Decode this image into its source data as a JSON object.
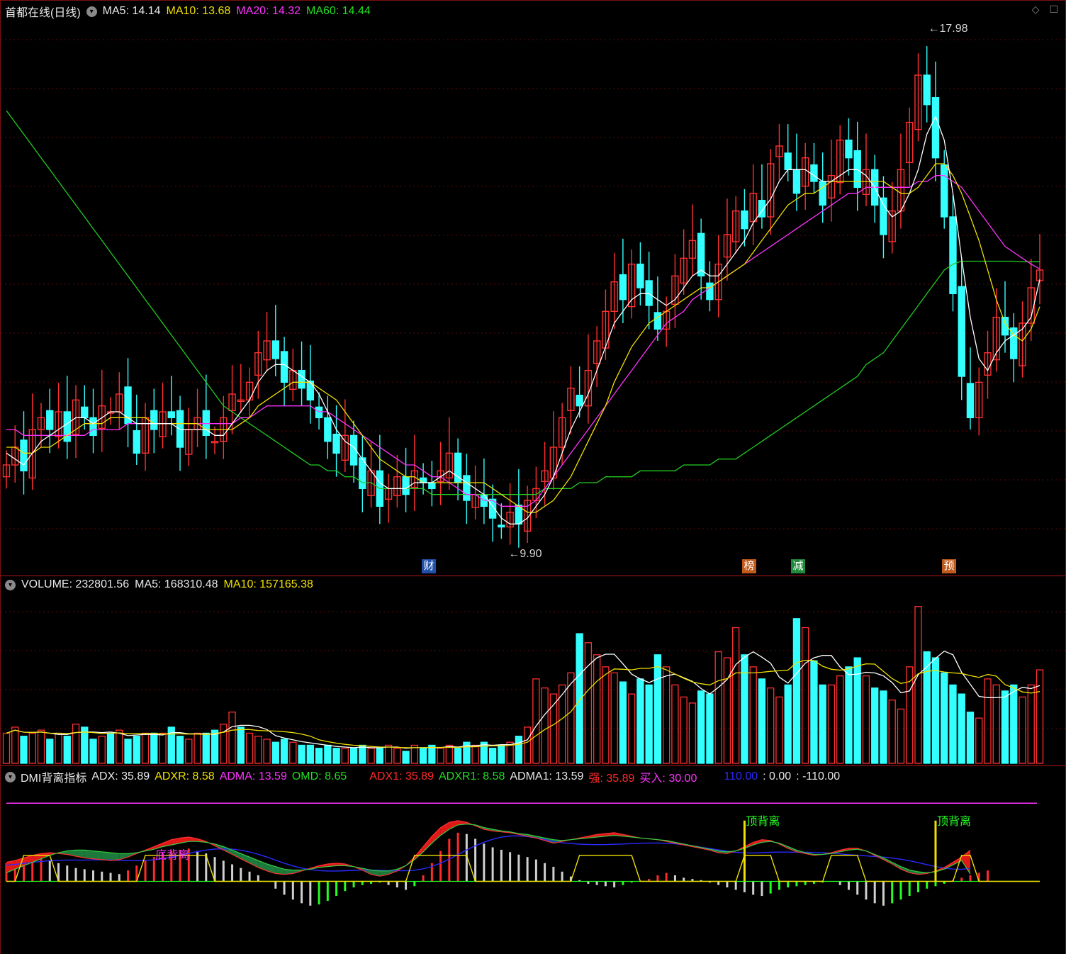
{
  "price": {
    "title": "首都在线(日线)",
    "ma5_label": "MA5:",
    "ma5": "14.14",
    "ma10_label": "MA10:",
    "ma10": "13.68",
    "ma20_label": "MA20:",
    "ma20": "14.32",
    "ma60_label": "MA60:",
    "ma60": "14.44",
    "high_label": "17.98",
    "low_label": "9.90",
    "signals": [
      {
        "text": "财",
        "color": "#1f4fa8"
      },
      {
        "text": "榜",
        "color": "#c05a1a"
      },
      {
        "text": "减",
        "color": "#1f8a3a"
      },
      {
        "text": "预",
        "color": "#c05a1a"
      }
    ],
    "icons": [
      "diamond-icon",
      "maximize-icon"
    ]
  },
  "volume": {
    "label": "VOLUME:",
    "value": "232801.56",
    "ma5_label": "MA5:",
    "ma5": "168310.48",
    "ma10_label": "MA10:",
    "ma10": "157165.38"
  },
  "dmi": {
    "title": "DMI背离指标",
    "adx_label": "ADX:",
    "adx": "35.89",
    "adxr_label": "ADXR:",
    "adxr": "8.58",
    "adma_label": "ADMA:",
    "adma": "13.59",
    "omd_label": "OMD:",
    "omd": "8.65",
    "adx1_label": "ADX1:",
    "adx1": "35.89",
    "adxr1_label": "ADXR1:",
    "adxr1": "8.58",
    "adma1_label": "ADMA1:",
    "adma1": "13.59",
    "strong_label": "强:",
    "strong": "35.89",
    "buy_label": "买入:",
    "buy": "30.00",
    "v1": "110.00",
    "v2_label": ":",
    "v2": "0.00",
    "v3_label": ":",
    "v3": "-110.00",
    "annotations": [
      "底背离",
      "顶背离",
      "顶背离"
    ]
  },
  "colors": {
    "up": "#ff3030",
    "down": "#33ffff",
    "ma5": "#ffffff",
    "ma10": "#f0e000",
    "ma20": "#ff33ff",
    "ma60": "#22cc22"
  },
  "chart_data": {
    "type": "candlestick",
    "n": 120,
    "price_range": [
      9.5,
      18.5
    ],
    "close": [
      11.0,
      11.3,
      10.9,
      11.6,
      11.8,
      11.6,
      11.9,
      11.4,
      12.1,
      11.8,
      11.5,
      12.0,
      11.9,
      12.2,
      11.7,
      11.2,
      11.8,
      11.6,
      11.9,
      11.8,
      11.3,
      11.6,
      11.8,
      11.5,
      11.4,
      11.8,
      12.2,
      12.1,
      12.4,
      12.9,
      13.1,
      12.8,
      12.4,
      12.6,
      12.3,
      12.1,
      11.8,
      11.4,
      11.2,
      11.5,
      11.0,
      10.6,
      10.9,
      10.3,
      10.6,
      10.8,
      10.5,
      10.9,
      10.7,
      10.6,
      10.9,
      11.2,
      10.7,
      10.4,
      10.5,
      10.3,
      10.1,
      9.95,
      10.2,
      10.0,
      10.4,
      10.6,
      10.9,
      11.3,
      11.8,
      12.3,
      12.0,
      12.6,
      13.1,
      13.6,
      14.1,
      13.8,
      14.4,
      14.0,
      13.7,
      13.3,
      13.6,
      14.2,
      14.5,
      14.8,
      14.2,
      13.8,
      14.4,
      14.9,
      15.3,
      15.0,
      15.6,
      15.2,
      16.1,
      16.4,
      16.0,
      15.6,
      16.2,
      15.8,
      15.4,
      15.9,
      16.5,
      16.2,
      15.7,
      16.0,
      15.4,
      14.9,
      15.3,
      16.0,
      16.8,
      17.6,
      17.1,
      16.2,
      15.2,
      13.9,
      12.5,
      11.8,
      12.4,
      12.9,
      13.5,
      13.2,
      12.8,
      13.4,
      14.0,
      14.3
    ],
    "ma5": [
      11.2,
      11.1,
      11.0,
      11.2,
      11.4,
      11.5,
      11.6,
      11.7,
      11.8,
      11.8,
      11.7,
      11.8,
      11.9,
      11.9,
      11.8,
      11.7,
      11.7,
      11.7,
      11.7,
      11.7,
      11.6,
      11.6,
      11.6,
      11.6,
      11.5,
      11.5,
      11.7,
      11.9,
      12.1,
      12.4,
      12.6,
      12.7,
      12.7,
      12.6,
      12.5,
      12.4,
      12.2,
      11.9,
      11.6,
      11.4,
      11.3,
      11.1,
      10.9,
      10.7,
      10.6,
      10.6,
      10.6,
      10.7,
      10.7,
      10.7,
      10.8,
      10.9,
      10.8,
      10.7,
      10.6,
      10.5,
      10.3,
      10.1,
      10.0,
      10.0,
      10.1,
      10.3,
      10.5,
      10.8,
      11.2,
      11.6,
      11.9,
      12.2,
      12.6,
      13.0,
      13.4,
      13.6,
      13.8,
      13.9,
      13.9,
      13.8,
      13.7,
      13.8,
      14.0,
      14.2,
      14.3,
      14.2,
      14.2,
      14.4,
      14.6,
      14.8,
      15.1,
      15.3,
      15.5,
      15.8,
      16.0,
      16.0,
      16.0,
      15.9,
      15.8,
      15.8,
      15.9,
      16.0,
      16.0,
      15.9,
      15.7,
      15.4,
      15.2,
      15.3,
      15.6,
      16.0,
      16.6,
      16.9,
      16.5,
      15.6,
      14.5,
      13.5,
      12.8,
      12.6,
      12.9,
      13.1,
      13.2,
      13.3,
      13.5,
      14.14
    ],
    "ma10": [
      11.3,
      11.3,
      11.2,
      11.2,
      11.3,
      11.3,
      11.4,
      11.5,
      11.6,
      11.7,
      11.7,
      11.7,
      11.8,
      11.8,
      11.8,
      11.8,
      11.8,
      11.7,
      11.7,
      11.7,
      11.7,
      11.7,
      11.7,
      11.6,
      11.6,
      11.6,
      11.6,
      11.7,
      11.8,
      12.0,
      12.1,
      12.2,
      12.3,
      12.4,
      12.4,
      12.4,
      12.3,
      12.2,
      12.1,
      11.9,
      11.7,
      11.5,
      11.3,
      11.1,
      11.0,
      10.9,
      10.8,
      10.8,
      10.7,
      10.7,
      10.7,
      10.7,
      10.7,
      10.7,
      10.7,
      10.7,
      10.6,
      10.5,
      10.4,
      10.3,
      10.2,
      10.2,
      10.3,
      10.4,
      10.6,
      10.8,
      11.1,
      11.4,
      11.7,
      12.0,
      12.4,
      12.7,
      13.0,
      13.2,
      13.4,
      13.5,
      13.6,
      13.7,
      13.8,
      13.9,
      14.0,
      14.0,
      14.1,
      14.2,
      14.3,
      14.4,
      14.6,
      14.8,
      15.0,
      15.2,
      15.4,
      15.5,
      15.6,
      15.6,
      15.7,
      15.8,
      15.8,
      15.8,
      15.8,
      15.8,
      15.8,
      15.8,
      15.7,
      15.6,
      15.6,
      15.7,
      15.9,
      16.1,
      16.1,
      15.9,
      15.6,
      15.2,
      14.8,
      14.3,
      13.8,
      13.4,
      13.2,
      13.1,
      13.3,
      13.68
    ],
    "ma20": [
      11.6,
      11.6,
      11.5,
      11.5,
      11.5,
      11.5,
      11.5,
      11.5,
      11.5,
      11.5,
      11.6,
      11.6,
      11.6,
      11.6,
      11.7,
      11.7,
      11.7,
      11.7,
      11.7,
      11.7,
      11.7,
      11.7,
      11.7,
      11.7,
      11.7,
      11.7,
      11.7,
      11.8,
      11.8,
      11.9,
      12.0,
      12.0,
      12.0,
      12.0,
      12.0,
      12.0,
      11.9,
      11.9,
      11.8,
      11.7,
      11.6,
      11.5,
      11.4,
      11.3,
      11.2,
      11.1,
      11.0,
      11.0,
      10.9,
      10.8,
      10.8,
      10.7,
      10.6,
      10.5,
      10.5,
      10.4,
      10.4,
      10.3,
      10.3,
      10.3,
      10.3,
      10.4,
      10.6,
      10.8,
      11.0,
      11.2,
      11.4,
      11.6,
      11.8,
      12.0,
      12.2,
      12.4,
      12.6,
      12.8,
      13.0,
      13.2,
      13.4,
      13.5,
      13.6,
      13.8,
      13.9,
      14.0,
      14.1,
      14.2,
      14.3,
      14.4,
      14.5,
      14.6,
      14.7,
      14.8,
      14.9,
      15.0,
      15.1,
      15.2,
      15.3,
      15.4,
      15.5,
      15.6,
      15.6,
      15.7,
      15.7,
      15.7,
      15.7,
      15.7,
      15.7,
      15.8,
      15.8,
      15.9,
      15.9,
      15.8,
      15.7,
      15.5,
      15.3,
      15.1,
      14.9,
      14.7,
      14.6,
      14.5,
      14.4,
      14.32
    ],
    "ma60": [
      17.0,
      16.8,
      16.6,
      16.4,
      16.2,
      16.0,
      15.8,
      15.6,
      15.4,
      15.2,
      15.0,
      14.8,
      14.6,
      14.4,
      14.2,
      14.0,
      13.8,
      13.6,
      13.4,
      13.2,
      13.0,
      12.8,
      12.6,
      12.4,
      12.2,
      12.0,
      11.9,
      11.8,
      11.7,
      11.6,
      11.5,
      11.4,
      11.3,
      11.2,
      11.1,
      11.0,
      11.0,
      10.9,
      10.9,
      10.8,
      10.8,
      10.7,
      10.7,
      10.6,
      10.6,
      10.6,
      10.6,
      10.6,
      10.6,
      10.5,
      10.5,
      10.5,
      10.5,
      10.5,
      10.5,
      10.5,
      10.5,
      10.5,
      10.5,
      10.5,
      10.5,
      10.5,
      10.6,
      10.6,
      10.6,
      10.6,
      10.7,
      10.7,
      10.7,
      10.8,
      10.8,
      10.8,
      10.8,
      10.9,
      10.9,
      10.9,
      10.9,
      10.9,
      11.0,
      11.0,
      11.0,
      11.0,
      11.1,
      11.1,
      11.1,
      11.2,
      11.3,
      11.4,
      11.5,
      11.6,
      11.7,
      11.8,
      11.9,
      12.0,
      12.1,
      12.2,
      12.3,
      12.4,
      12.5,
      12.7,
      12.8,
      12.9,
      13.1,
      13.3,
      13.5,
      13.7,
      13.9,
      14.1,
      14.3,
      14.4,
      14.45,
      14.45,
      14.45,
      14.45,
      14.45,
      14.45,
      14.45,
      14.44,
      14.44,
      14.44
    ],
    "volume": [
      1,
      1.2,
      0.9,
      1,
      1.1,
      0.8,
      1,
      0.9,
      1.3,
      1.2,
      0.8,
      0.9,
      1,
      1.1,
      0.8,
      0.9,
      1,
      1,
      1,
      1.2,
      0.9,
      0.8,
      1,
      1,
      1.1,
      1.3,
      1.7,
      1.2,
      1,
      0.9,
      0.8,
      0.7,
      0.8,
      0.7,
      0.6,
      0.6,
      0.5,
      0.6,
      0.5,
      0.5,
      0.5,
      0.6,
      0.5,
      0.5,
      0.6,
      0.5,
      0.4,
      0.6,
      0.5,
      0.6,
      0.5,
      0.6,
      0.5,
      0.7,
      0.6,
      0.7,
      0.5,
      0.6,
      0.7,
      0.9,
      1.2,
      2.8,
      2.5,
      2.3,
      2.6,
      3,
      4.3,
      4,
      3.6,
      3.2,
      3,
      2.7,
      2.3,
      2.8,
      2.6,
      3.6,
      3.2,
      2.6,
      2.2,
      2,
      2.4,
      2.3,
      3.7,
      3.5,
      4.5,
      3.6,
      3.2,
      2.8,
      2.5,
      2.2,
      2.6,
      4.8,
      4.5,
      3.4,
      2.6,
      2.6,
      2.9,
      3.2,
      3.5,
      2.9,
      2.5,
      2.4,
      2.1,
      1.8,
      3.2,
      5.2,
      3.7,
      3.5,
      3,
      2.6,
      2.3,
      1.7,
      1.5,
      2.8,
      2.6,
      2.4,
      2.6,
      2.2,
      2.6,
      3.1
    ],
    "dmi_adx": [
      22,
      24,
      27,
      30,
      32,
      33,
      32,
      31,
      29,
      27,
      26,
      25,
      24,
      25,
      28,
      32,
      36,
      40,
      44,
      48,
      50,
      51,
      49,
      46,
      41,
      36,
      31,
      26,
      21,
      16,
      12,
      9,
      8,
      9,
      12,
      15,
      18,
      20,
      21,
      20,
      17,
      13,
      8,
      6,
      8,
      12,
      18,
      28,
      40,
      52,
      62,
      68,
      70,
      68,
      64,
      60,
      58,
      57,
      56,
      54,
      52,
      50,
      47,
      44,
      46,
      48,
      50,
      52,
      54,
      55,
      56,
      54,
      52,
      50,
      49,
      48,
      46,
      44,
      42,
      40,
      38,
      36,
      33,
      32,
      35,
      40,
      45,
      48,
      47,
      43,
      38,
      34,
      32,
      30,
      31,
      33,
      36,
      38,
      38,
      35,
      30,
      25,
      20,
      14,
      10,
      8,
      9,
      12,
      16,
      22,
      28,
      35.89
    ],
    "dmi_adxr": [
      10,
      14,
      18,
      22,
      26,
      30,
      33,
      35,
      36,
      36,
      35,
      34,
      33,
      32,
      32,
      33,
      35,
      37,
      40,
      42,
      44,
      46,
      46,
      45,
      43,
      40,
      36,
      32,
      28,
      24,
      20,
      17,
      14,
      13,
      13,
      14,
      16,
      17,
      18,
      18,
      17,
      15,
      13,
      12,
      12,
      14,
      18,
      25,
      34,
      44,
      53,
      60,
      65,
      66,
      65,
      62,
      60,
      58,
      57,
      55,
      54,
      52,
      50,
      48,
      47,
      48,
      49,
      50,
      51,
      52,
      53,
      52,
      51,
      50,
      49,
      48,
      47,
      45,
      43,
      41,
      39,
      37,
      35,
      34,
      35,
      38,
      42,
      45,
      46,
      44,
      40,
      36,
      33,
      31,
      31,
      32,
      34,
      36,
      37,
      35,
      31,
      27,
      22,
      17,
      13,
      11,
      10,
      11,
      14,
      19,
      24,
      8.58
    ],
    "dmi_hist": [
      30,
      32,
      36,
      38,
      40,
      35,
      30,
      26,
      22,
      20,
      18,
      16,
      14,
      12,
      18,
      26,
      34,
      40,
      46,
      50,
      52,
      54,
      50,
      46,
      40,
      34,
      28,
      22,
      16,
      10,
      0,
      -12,
      -22,
      -30,
      -36,
      -40,
      -38,
      -32,
      -24,
      -16,
      -10,
      -6,
      -4,
      -2,
      -6,
      -10,
      -14,
      -8,
      10,
      30,
      50,
      70,
      80,
      78,
      70,
      62,
      56,
      52,
      48,
      44,
      40,
      36,
      30,
      24,
      16,
      8,
      2,
      -4,
      -6,
      -8,
      -10,
      -6,
      -2,
      0,
      4,
      10,
      14,
      10,
      6,
      4,
      2,
      -2,
      -6,
      -10,
      -14,
      -18,
      -22,
      -24,
      -20,
      -14,
      -10,
      -8,
      -6,
      -4,
      -2,
      0,
      -6,
      -14,
      -22,
      -30,
      -36,
      -40,
      -36,
      -30,
      -24,
      -18,
      -12,
      -8,
      -4,
      2,
      6,
      10,
      14,
      18
    ],
    "dmi_ref_line": 30,
    "dmi_zero": 0,
    "dmi_range": [
      -60,
      100
    ]
  }
}
